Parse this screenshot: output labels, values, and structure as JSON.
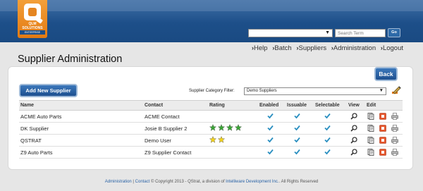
{
  "logo": {
    "line1": "QLM",
    "line2": "SOLUTIONS",
    "line3": "ENTERPRISE"
  },
  "header": {
    "search_select_value": "",
    "search_placeholder": "Search Term",
    "go_label": "Go"
  },
  "nav": {
    "items": [
      "Help",
      "Batch",
      "Suppliers",
      "Administration",
      "Logout"
    ]
  },
  "page": {
    "title": "Supplier Administration"
  },
  "buttons": {
    "back": "Back",
    "add_supplier": "Add New Supplier"
  },
  "filter": {
    "label": "Supplier Category Filter:",
    "selected": "Demo Suppliers"
  },
  "table": {
    "columns": [
      "Name",
      "Contact",
      "Rating",
      "Enabled",
      "Issuable",
      "Selectable",
      "View",
      "Edit"
    ],
    "rows": [
      {
        "name": "ACME Auto Parts",
        "contact": "ACME Contact",
        "rating": 0,
        "enabled": true,
        "issuable": true,
        "selectable": true
      },
      {
        "name": "DK Supplier",
        "contact": "Josie B Supplier 2",
        "rating": 4,
        "enabled": true,
        "issuable": true,
        "selectable": true
      },
      {
        "name": "QSTRAT",
        "contact": "Demo User",
        "rating": 2,
        "enabled": true,
        "issuable": true,
        "selectable": true
      },
      {
        "name": "Z9 Auto Parts",
        "contact": "Z9 Supplier Contact",
        "rating": 0,
        "enabled": true,
        "issuable": true,
        "selectable": true
      }
    ]
  },
  "footer": {
    "link_admin": "Administration",
    "separator": "|",
    "link_contact": "Contact",
    "copyright": "© Copyright 2013 - QStrat, a division of",
    "company": "Intelliware Development Inc.",
    "rights": "All Rights Reserved"
  },
  "colors": {
    "header_blue": "#1d4f89",
    "accent_orange": "#e37a12",
    "check_blue": "#2a8fc0",
    "star_green": "#3aa335",
    "star_yellow": "#f2d21b"
  }
}
